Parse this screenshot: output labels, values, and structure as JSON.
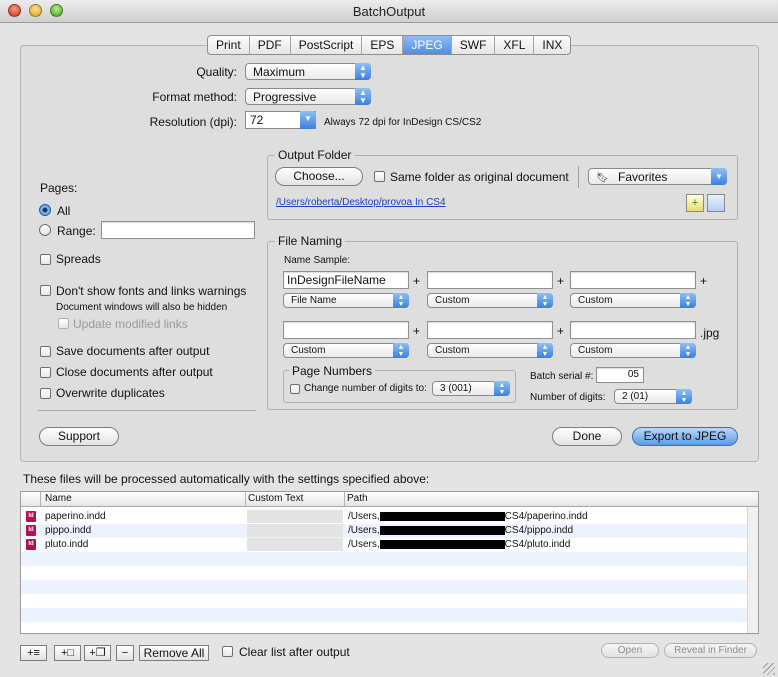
{
  "window": {
    "title": "BatchOutput"
  },
  "tabs": [
    "Print",
    "PDF",
    "PostScript",
    "EPS",
    "JPEG",
    "SWF",
    "XFL",
    "INX"
  ],
  "active_tab": "JPEG",
  "quality": {
    "label": "Quality:",
    "value": "Maximum"
  },
  "format_method": {
    "label": "Format method:",
    "value": "Progressive"
  },
  "resolution": {
    "label": "Resolution (dpi):",
    "value": "72",
    "note": "Always 72 dpi for InDesign CS/CS2"
  },
  "pages": {
    "label": "Pages:",
    "all_label": "All",
    "range_label": "Range:",
    "range_value": "",
    "selected": "All"
  },
  "spreads": {
    "label": "Spreads",
    "checked": false
  },
  "dont_show_warnings": {
    "label": "Don't show fonts and links warnings",
    "note": "Document windows will also be hidden",
    "checked": false
  },
  "update_links": {
    "label": "Update modified links",
    "checked": false,
    "disabled": true
  },
  "save_after": {
    "label": "Save documents after output",
    "checked": false
  },
  "close_after": {
    "label": "Close documents after output",
    "checked": false
  },
  "overwrite": {
    "label": "Overwrite duplicates",
    "checked": false
  },
  "output_folder": {
    "title": "Output Folder",
    "choose_label": "Choose...",
    "same_folder_label": "Same folder as original document",
    "same_folder_checked": false,
    "favorites_label": "Favorites",
    "path": "/Users/roberta/Desktop/provoa In CS4"
  },
  "file_naming": {
    "title": "File Naming",
    "sample_label": "Name Sample:",
    "row1_fields": [
      "InDesignFileName",
      "",
      ""
    ],
    "row1_selects": [
      "File Name",
      "Custom",
      "Custom"
    ],
    "row2_fields": [
      "",
      "",
      ""
    ],
    "row2_selects": [
      "Custom",
      "Custom",
      "Custom"
    ],
    "plus": "+",
    "extension": ".jpg",
    "page_numbers": {
      "title": "Page Numbers",
      "change_digits_label": "Change number of digits to:",
      "checked": false,
      "digits_value": "3 (001)"
    },
    "batch_serial_label": "Batch serial #:",
    "batch_serial_value": "05",
    "num_digits_label": "Number of digits:",
    "num_digits_value": "2 (01)"
  },
  "buttons": {
    "support": "Support",
    "done": "Done",
    "export": "Export to JPEG"
  },
  "files_note": "These files will be processed automatically with the settings specified above:",
  "file_list": {
    "columns": [
      "Name",
      "Custom Text",
      "Path"
    ],
    "rows": [
      {
        "name": "paperino.indd",
        "custom": "",
        "path_prefix": "/Users,",
        "path_suffix": "CS4/paperino.indd"
      },
      {
        "name": "pippo.indd",
        "custom": "",
        "path_prefix": "/Users,",
        "path_suffix": "CS4/pippo.indd"
      },
      {
        "name": "pluto.indd",
        "custom": "",
        "path_prefix": "/Users,",
        "path_suffix": "CS4/pluto.indd"
      }
    ]
  },
  "bottom": {
    "add_list": "+≡",
    "add_file": "+□",
    "add_folder": "+❐",
    "remove": "−",
    "remove_all": "Remove All",
    "clear_list_label": "Clear list after output",
    "clear_list_checked": false,
    "open": "Open",
    "reveal": "Reveal in Finder"
  }
}
